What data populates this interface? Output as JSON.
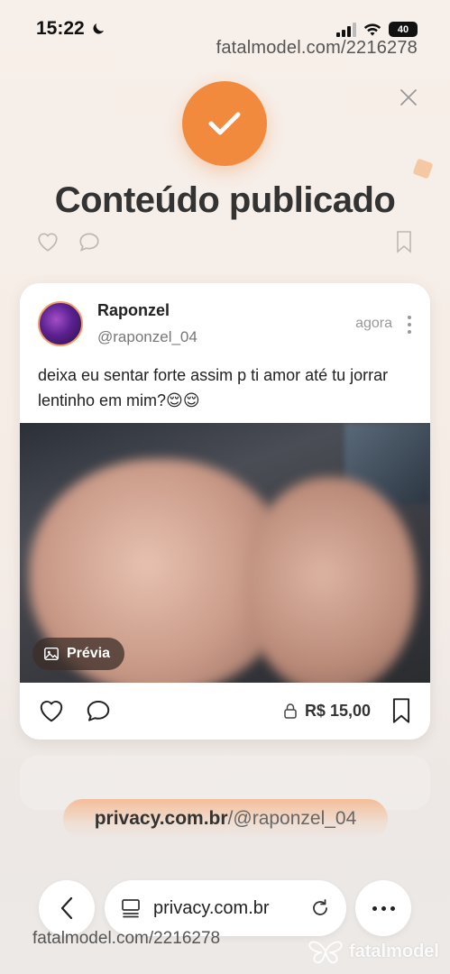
{
  "status_bar": {
    "time": "15:22",
    "battery": "40"
  },
  "watermark": {
    "top": "fatalmodel.com/2216278",
    "bottom": "fatalmodel.com/2216278",
    "logo_text": "fatalmodel"
  },
  "header": {
    "title": "Conteúdo publicado"
  },
  "post": {
    "username": "Raponzel",
    "handle": "@raponzel_04",
    "timestamp": "agora",
    "caption": "deixa eu sentar forte assim p ti amor até tu jorrar lentinho em mim?😌😌",
    "preview_label": "Prévia",
    "price": "R$ 15,00"
  },
  "profile_link": {
    "domain": "privacy.com.br",
    "path": "/@raponzel_04"
  },
  "browser": {
    "url": "privacy.com.br"
  },
  "colors": {
    "accent": "#f28a3e",
    "background": "#f7efe9"
  }
}
